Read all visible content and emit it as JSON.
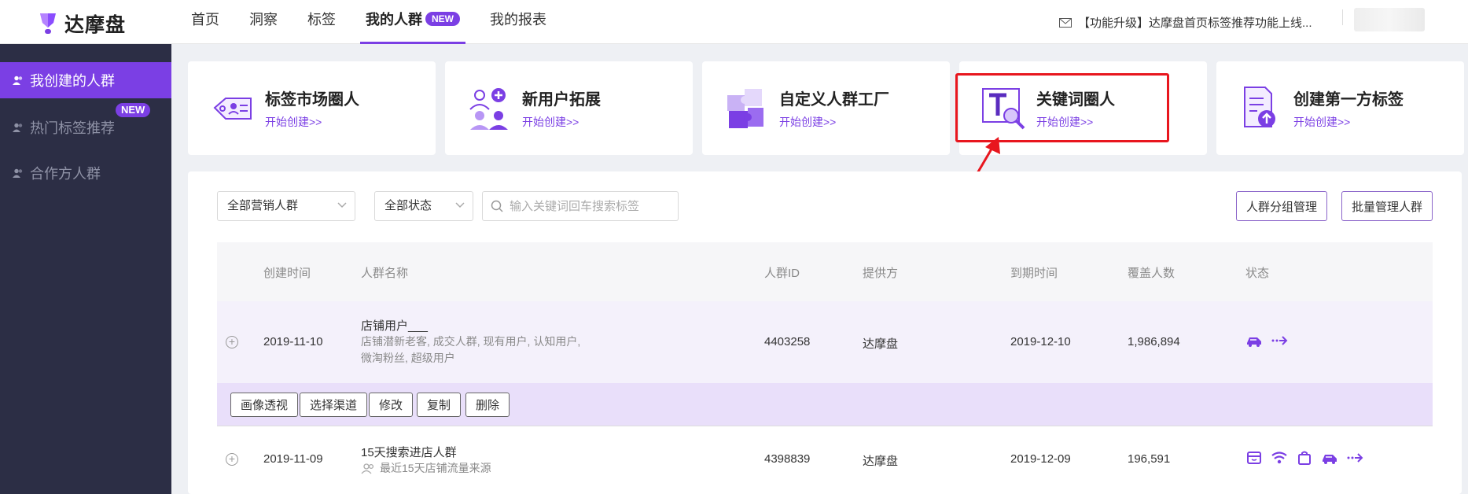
{
  "brand": {
    "name": "达摩盘"
  },
  "nav": [
    {
      "label": "首页"
    },
    {
      "label": "洞察"
    },
    {
      "label": "标签"
    },
    {
      "label": "我的人群",
      "badge": "NEW"
    },
    {
      "label": "我的报表"
    }
  ],
  "notice": {
    "text": "【功能升级】达摩盘首页标签推荐功能上线..."
  },
  "sidebar": [
    {
      "label": "我创建的人群"
    },
    {
      "label": "热门标签推荐",
      "badge": "NEW"
    },
    {
      "label": "合作方人群"
    }
  ],
  "cards": [
    {
      "title": "标签市场圈人",
      "link": "开始创建>>"
    },
    {
      "title": "新用户拓展",
      "link": "开始创建>>"
    },
    {
      "title": "自定义人群工厂",
      "link": "开始创建>>"
    },
    {
      "title": "关键词圈人",
      "link": "开始创建>>"
    },
    {
      "title": "创建第一方标签",
      "link": "开始创建>>"
    }
  ],
  "filters": {
    "campaign": "全部营销人群",
    "status": "全部状态",
    "search_placeholder": "输入关键词回车搜索标签",
    "group_btn": "人群分组管理",
    "batch_btn": "批量管理人群"
  },
  "table": {
    "headers": [
      "创建时间",
      "人群名称",
      "人群ID",
      "提供方",
      "到期时间",
      "覆盖人数",
      "状态"
    ],
    "rows": [
      {
        "created": "2019-11-10",
        "name": "店铺用户___",
        "desc1": "店铺潜新老客, 成交人群, 现有用户, 认知用户,",
        "desc2": "微淘粉丝, 超级用户",
        "id": "4403258",
        "provider": "达摩盘",
        "expire": "2019-12-10",
        "coverage": "1,986,894",
        "actions": [
          "画像透视",
          "选择渠道",
          "修改",
          "复制",
          "删除"
        ]
      },
      {
        "created": "2019-11-09",
        "name": "15天搜索进店人群",
        "desc1": "最近15天店铺流量来源",
        "id": "4398839",
        "provider": "达摩盘",
        "expire": "2019-12-09",
        "coverage": "196,591"
      }
    ]
  },
  "colors": {
    "accent": "#7b3fe4",
    "sidebar": "#2c2e45",
    "highlight": "#e8161e"
  }
}
